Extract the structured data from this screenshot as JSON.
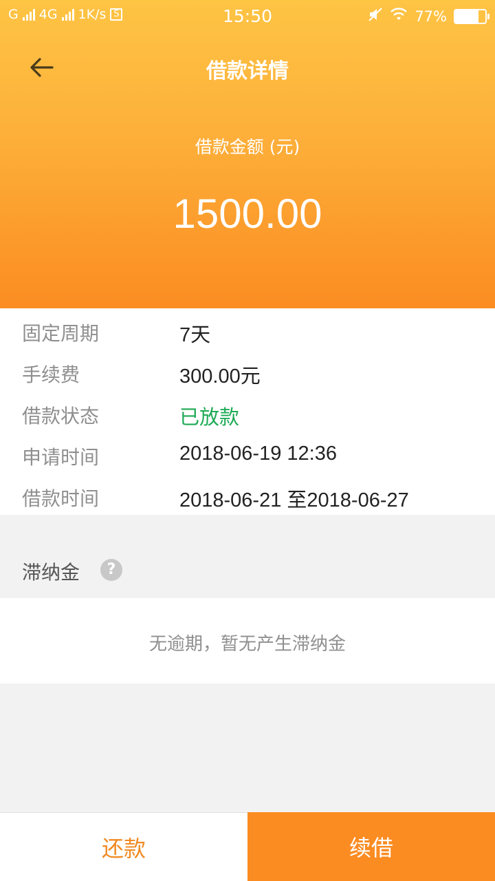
{
  "status_bar": {
    "carrier1": "G",
    "carrier2": "4G",
    "speed": "1K/s",
    "sbadge": "S",
    "time": "15:50",
    "battery": "77%",
    "battery_level": 0.77
  },
  "header": {
    "title": "借款详情",
    "amount_label": "借款金额 (元)",
    "amount": "1500.00"
  },
  "details": [
    {
      "label": "固定周期",
      "value": "7天"
    },
    {
      "label": "手续费",
      "value": "300.00元"
    },
    {
      "label": "借款状态",
      "value": "已放款"
    },
    {
      "label": "申请时间",
      "value": "2018-06-19  12:36"
    },
    {
      "label": "借款时间",
      "value": "2018-06-21 至2018-06-27"
    }
  ],
  "late_fee": {
    "label": "滞纳金",
    "help": "?",
    "message": "无逾期，暂无产生滞纳金"
  },
  "actions": {
    "repay": "还款",
    "renew": "续借"
  },
  "colors": {
    "accent": "#fb8c22",
    "status_green": "#1eaa55"
  }
}
